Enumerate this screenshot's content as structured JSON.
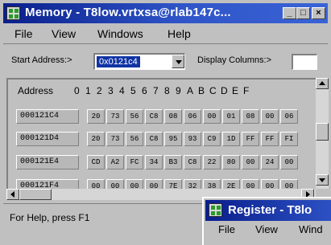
{
  "memory_window": {
    "title": "Memory - T8low.vrtxsa@rlab147c...",
    "buttons": {
      "minimize": "_",
      "maximize": "□",
      "close": "×"
    },
    "menu": [
      "File",
      "View",
      "Windows",
      "Help"
    ],
    "toolbar": {
      "start_address_label": "Start Address:>",
      "start_address_value": "0x0121c4",
      "display_columns_label": "Display Columns:>",
      "display_columns_value": ""
    },
    "grid": {
      "header_address": "Address",
      "header_columns": [
        "0",
        "1",
        "2",
        "3",
        "4",
        "5",
        "6",
        "7",
        "8",
        "9",
        "A",
        "B",
        "C",
        "D",
        "E",
        "F"
      ],
      "rows": [
        {
          "address": "000121C4",
          "bytes": [
            "20",
            "73",
            "56",
            "C8",
            "08",
            "06",
            "00",
            "01",
            "08",
            "00",
            "06"
          ]
        },
        {
          "address": "000121D4",
          "bytes": [
            "20",
            "73",
            "56",
            "C8",
            "95",
            "93",
            "C9",
            "1D",
            "FF",
            "FF",
            "FI"
          ]
        },
        {
          "address": "000121E4",
          "bytes": [
            "CD",
            "A2",
            "FC",
            "34",
            "B3",
            "C8",
            "22",
            "80",
            "00",
            "24",
            "00"
          ]
        },
        {
          "address": "000121F4",
          "bytes": [
            "00",
            "00",
            "00",
            "00",
            "7E",
            "32",
            "38",
            "2E",
            "00",
            "00",
            "00"
          ]
        }
      ]
    },
    "status": "For Help, press F1"
  },
  "register_window": {
    "title": "Register - T8lo",
    "menu": [
      "File",
      "View",
      "Wind"
    ]
  },
  "colors": {
    "titlebar_start": "#0a1f8c",
    "titlebar_end": "#3a63d6",
    "face": "#c0c0c0",
    "selection": "#1033a4"
  }
}
